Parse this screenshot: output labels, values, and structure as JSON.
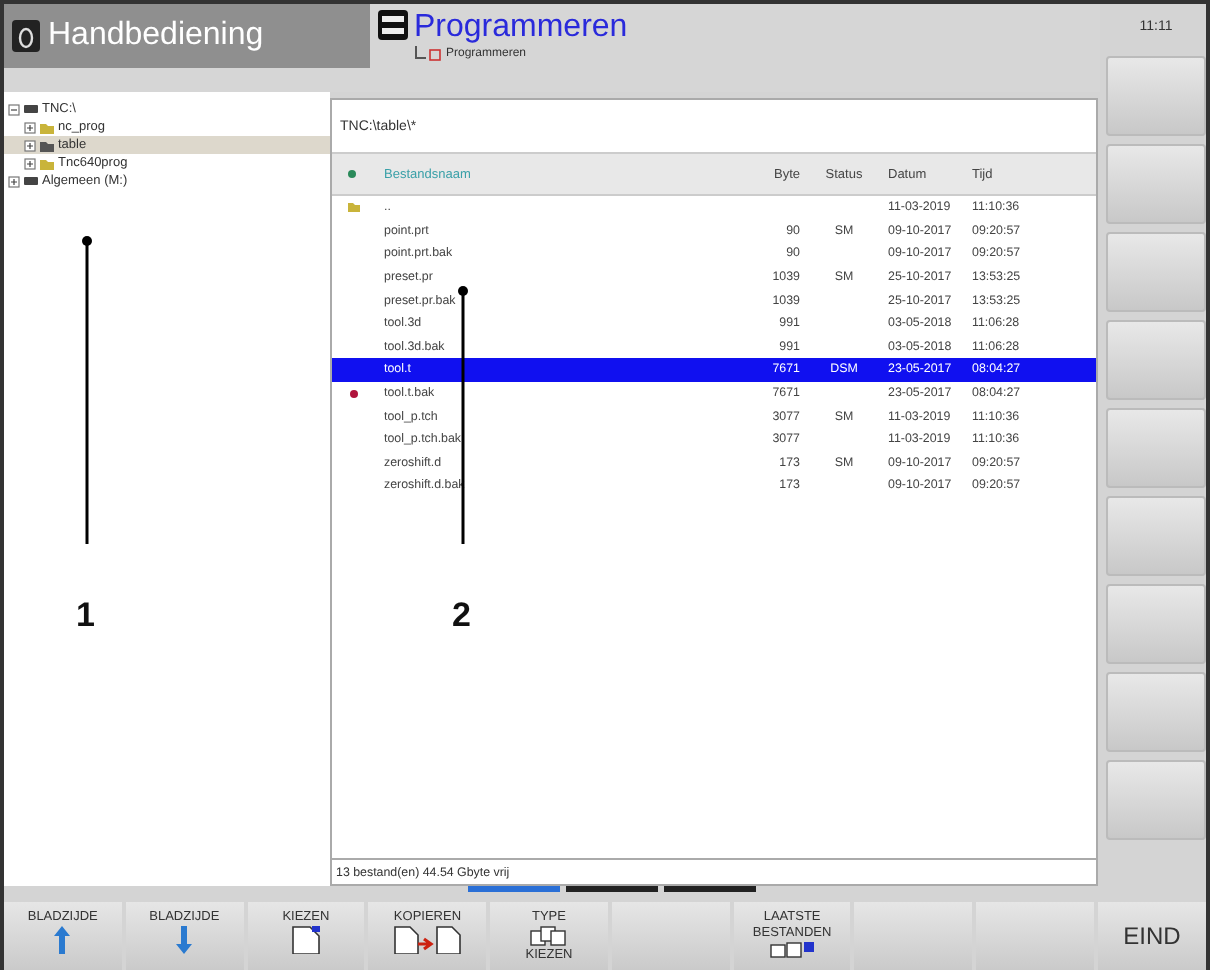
{
  "header": {
    "mode_tab": {
      "label": "Handbediening"
    },
    "active_tab": {
      "title": "Programmeren",
      "subtitle": "Programmeren"
    },
    "clock": "11:11"
  },
  "tree": [
    {
      "label": "TNC:\\",
      "kind": "drive",
      "expanded": true,
      "selected": false,
      "children": [
        {
          "label": "nc_prog",
          "kind": "folder",
          "expanded": false,
          "selected": false
        },
        {
          "label": "table",
          "kind": "folder",
          "expanded": false,
          "selected": true
        },
        {
          "label": "Tnc640prog",
          "kind": "folder",
          "expanded": false,
          "selected": false
        }
      ]
    },
    {
      "label": "Algemeen (M:)",
      "kind": "drive",
      "expanded": false,
      "selected": false
    }
  ],
  "file_panel": {
    "path": "TNC:\\table\\*",
    "columns": [
      "Bestandsnaam",
      "Byte",
      "Status",
      "Datum",
      "Tijd"
    ],
    "rows": [
      {
        "kind": "folder",
        "name": "..",
        "date": "11-03-2019",
        "time": "11:10:36",
        "selected": false,
        "marked": false
      },
      {
        "kind": "file",
        "name": "point.prt",
        "byte": "90",
        "status": "SM",
        "date": "09-10-2017",
        "time": "09:20:57",
        "selected": false,
        "marked": false
      },
      {
        "kind": "file",
        "name": "point.prt.bak",
        "byte": "90",
        "date": "09-10-2017",
        "time": "09:20:57",
        "selected": false,
        "marked": false
      },
      {
        "kind": "file",
        "name": "preset.pr",
        "byte": "1039",
        "status": "SM",
        "date": "25-10-2017",
        "time": "13:53:25",
        "selected": false,
        "marked": false
      },
      {
        "kind": "file",
        "name": "preset.pr.bak",
        "byte": "1039",
        "date": "25-10-2017",
        "time": "13:53:25",
        "selected": false,
        "marked": false
      },
      {
        "kind": "file",
        "name": "tool.3d",
        "byte": "991",
        "date": "03-05-2018",
        "time": "11:06:28",
        "selected": false,
        "marked": false
      },
      {
        "kind": "file",
        "name": "tool.3d.bak",
        "byte": "991",
        "date": "03-05-2018",
        "time": "11:06:28",
        "selected": false,
        "marked": false
      },
      {
        "kind": "file",
        "name": "tool.t",
        "byte": "7671",
        "status": "DSM",
        "date": "23-05-2017",
        "time": "08:04:27",
        "selected": true,
        "marked": false
      },
      {
        "kind": "file",
        "name": "tool.t.bak",
        "byte": "7671",
        "date": "23-05-2017",
        "time": "08:04:27",
        "selected": false,
        "marked": true
      },
      {
        "kind": "file",
        "name": "tool_p.tch",
        "byte": "3077",
        "status": "SM",
        "date": "11-03-2019",
        "time": "11:10:36",
        "selected": false,
        "marked": false
      },
      {
        "kind": "file",
        "name": "tool_p.tch.bak",
        "byte": "3077",
        "date": "11-03-2019",
        "time": "11:10:36",
        "selected": false,
        "marked": false
      },
      {
        "kind": "file",
        "name": "zeroshift.d",
        "byte": "173",
        "status": "SM",
        "date": "09-10-2017",
        "time": "09:20:57",
        "selected": false,
        "marked": false
      },
      {
        "kind": "file",
        "name": "zeroshift.d.bak",
        "byte": "173",
        "date": "09-10-2017",
        "time": "09:20:57",
        "selected": false,
        "marked": false
      }
    ],
    "summary": "13 bestand(en) 44.54 Gbyte vrij"
  },
  "page_indicators": [
    {
      "selected": true
    },
    {
      "selected": false
    },
    {
      "selected": false
    }
  ],
  "softkeys": [
    {
      "label": "BLADZIJDE",
      "kind": "up"
    },
    {
      "label": "BLADZIJDE",
      "kind": "down"
    },
    {
      "label": "KIEZEN",
      "kind": "select"
    },
    {
      "label": "KOPIEREN",
      "kind": "copy"
    },
    {
      "label": "TYPE",
      "label2": "KIEZEN",
      "kind": "types"
    },
    {
      "kind": "blank"
    },
    {
      "label": "LAATSTE",
      "label2": "BESTANDEN",
      "kind": "recent"
    },
    {
      "kind": "blank"
    },
    {
      "kind": "blank"
    },
    {
      "label": "EIND",
      "kind": "end"
    }
  ],
  "callouts": [
    {
      "label": "1"
    },
    {
      "label": "2"
    }
  ]
}
